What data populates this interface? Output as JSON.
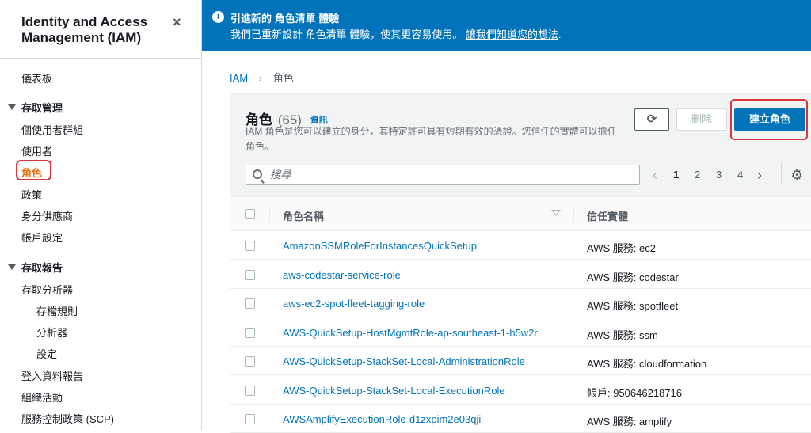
{
  "sidebar": {
    "title": "Identity and Access Management (IAM)",
    "close_label": "×",
    "dashboard": "儀表板",
    "access_mgmt_section": "存取管理",
    "access_mgmt_items": [
      "個使用者群組",
      "使用者",
      "角色",
      "政策",
      "身分供應商",
      "帳戶設定"
    ],
    "access_report_section": "存取報告",
    "analyzer": "存取分析器",
    "analyzer_sub": [
      "存檔規則",
      "分析器",
      "設定"
    ],
    "report_items": [
      "登入資料報告",
      "組織活動",
      "服務控制政策 (SCP)"
    ],
    "active_item": "角色"
  },
  "banner": {
    "title": "引進新的 角色清單 體驗",
    "text": "我們已重新設計 角色清單 體驗，使其更容易使用。",
    "link": "讓我們知道您的想法",
    "period": "."
  },
  "breadcrumb": {
    "root": "IAM",
    "current": "角色"
  },
  "panel": {
    "title": "角色",
    "count": "(65)",
    "info": "資訊",
    "description": "IAM 角色是您可以建立的身分，其特定許可具有短期有效的憑證。您信任的實體可以擔任角色。",
    "refresh_icon": "⟳",
    "delete_label": "刪除",
    "create_label": "建立角色",
    "search_placeholder": "搜尋",
    "pages": [
      "1",
      "2",
      "3",
      "4"
    ],
    "current_page": "1",
    "prev_icon": "‹",
    "next_icon": "›",
    "settings_icon": "⚙"
  },
  "table": {
    "columns": [
      "角色名稱",
      "信任實體"
    ],
    "rows": [
      {
        "name": "AmazonSSMRoleForInstancesQuickSetup",
        "trust": "AWS 服務: ec2"
      },
      {
        "name": "aws-codestar-service-role",
        "trust": "AWS 服務: codestar"
      },
      {
        "name": "aws-ec2-spot-fleet-tagging-role",
        "trust": "AWS 服務: spotfleet"
      },
      {
        "name": "AWS-QuickSetup-HostMgmtRole-ap-southeast-1-h5w2r",
        "trust": "AWS 服務: ssm"
      },
      {
        "name": "AWS-QuickSetup-StackSet-Local-AdministrationRole",
        "trust": "AWS 服務: cloudformation"
      },
      {
        "name": "AWS-QuickSetup-StackSet-Local-ExecutionRole",
        "trust": "帳戶: 950646218716"
      },
      {
        "name": "AWSAmplifyExecutionRole-d1zxpim2e03qji",
        "trust": "AWS 服務: amplify"
      }
    ]
  },
  "colors": {
    "primary": "#0073bb",
    "active": "#ec7211",
    "highlight": "#e0343c"
  }
}
